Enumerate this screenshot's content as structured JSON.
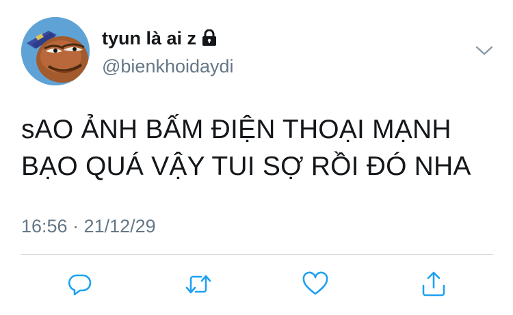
{
  "user": {
    "display_name": "tyun là ai z",
    "handle": "@bienkhoidaydi",
    "protected_icon": "lock-icon",
    "avatar_icon": "cartoon-fish-avatar"
  },
  "tweet": {
    "lines": [
      "sAO ẢNH BẤM ĐIỆN THOẠI MẠNH",
      "BẠO QUÁ VẬY TUI SỢ RỒI ĐÓ NHA"
    ],
    "timestamp": "16:56 · 21/12/29"
  },
  "actions": [
    {
      "icon": "reply-icon"
    },
    {
      "icon": "retweet-icon"
    },
    {
      "icon": "like-icon"
    },
    {
      "icon": "share-icon"
    }
  ],
  "colors": {
    "text": "#14171a",
    "secondary": "#657786",
    "icon": "#1da1f2",
    "divider": "#d6dbe0"
  }
}
